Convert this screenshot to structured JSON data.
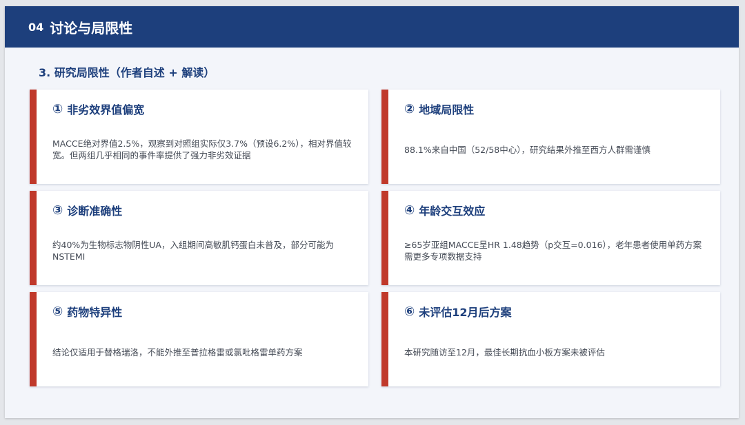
{
  "header": {
    "number": "04",
    "title": "讨论与局限性"
  },
  "subtitle": "3. 研究局限性（作者自述 + 解读）",
  "cards": [
    {
      "number": "①",
      "title": "非劣效界值偏宽",
      "body": "MACCE绝对界值2.5%，观察到对照组实际仅3.7%（预设6.2%），相对界值较宽。但两组几乎相同的事件率提供了强力非劣效证据"
    },
    {
      "number": "②",
      "title": "地域局限性",
      "body": "88.1%来自中国（52/58中心），研究结果外推至西方人群需谨慎"
    },
    {
      "number": "③",
      "title": "诊断准确性",
      "body": "约40%为生物标志物阴性UA，入组期间高敏肌钙蛋白未普及，部分可能为NSTEMI"
    },
    {
      "number": "④",
      "title": "年龄交互效应",
      "body": "≥65岁亚组MACCE呈HR 1.48趋势（p交互=0.016），老年患者使用单药方案需更多专项数据支持"
    },
    {
      "number": "⑤",
      "title": "药物特异性",
      "body": "结论仅适用于替格瑞洛，不能外推至普拉格雷或氯吡格雷单药方案"
    },
    {
      "number": "⑥",
      "title": "未评估12月后方案",
      "body": "本研究随访至12月，最佳长期抗血小板方案未被评估"
    }
  ],
  "colors": {
    "header_bg": "#1d3f7c",
    "accent_bar": "#c0392b",
    "title_text": "#1d3f7c"
  }
}
